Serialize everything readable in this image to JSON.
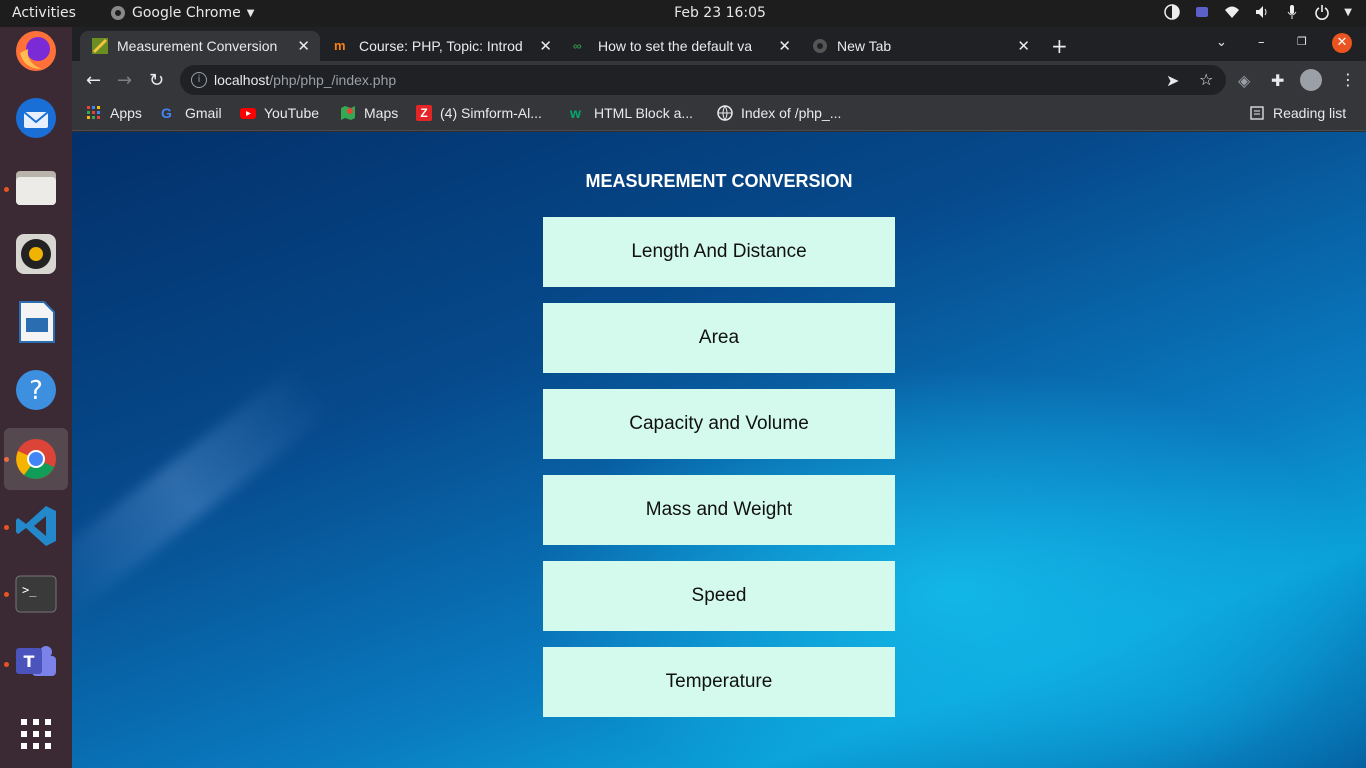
{
  "topbar": {
    "activities": "Activities",
    "app_name": "Google Chrome",
    "clock": "Feb 23  16:05"
  },
  "dock": {
    "items": [
      "firefox-icon",
      "thunderbird-icon",
      "files-icon",
      "rhythmbox-icon",
      "libreoffice-impress-icon",
      "help-icon",
      "chrome-icon",
      "vscode-icon",
      "terminal-icon",
      "teams-icon",
      "show-apps-icon"
    ]
  },
  "tabs": [
    {
      "title": "Measurement Conversion"
    },
    {
      "title": "Course: PHP, Topic: Introd"
    },
    {
      "title": "How to set the default va"
    },
    {
      "title": "New Tab"
    }
  ],
  "address": {
    "host": "localhost",
    "path": "/php/php_/index.php"
  },
  "bookmarks": [
    {
      "label": "Apps"
    },
    {
      "label": "Gmail"
    },
    {
      "label": "YouTube"
    },
    {
      "label": "Maps"
    },
    {
      "label": "(4) Simform-Al..."
    },
    {
      "label": "HTML Block a..."
    },
    {
      "label": "Index of /php_..."
    }
  ],
  "reading_list": "Reading list",
  "page": {
    "title": "MEASUREMENT CONVERSION",
    "buttons": [
      {
        "label": "Length And Distance"
      },
      {
        "label": "Area"
      },
      {
        "label": "Capacity and Volume"
      },
      {
        "label": "Mass and Weight"
      },
      {
        "label": "Speed"
      },
      {
        "label": "Temperature"
      }
    ]
  },
  "colors": {
    "button_bg": "#d3faec",
    "accent": "#e95420"
  }
}
